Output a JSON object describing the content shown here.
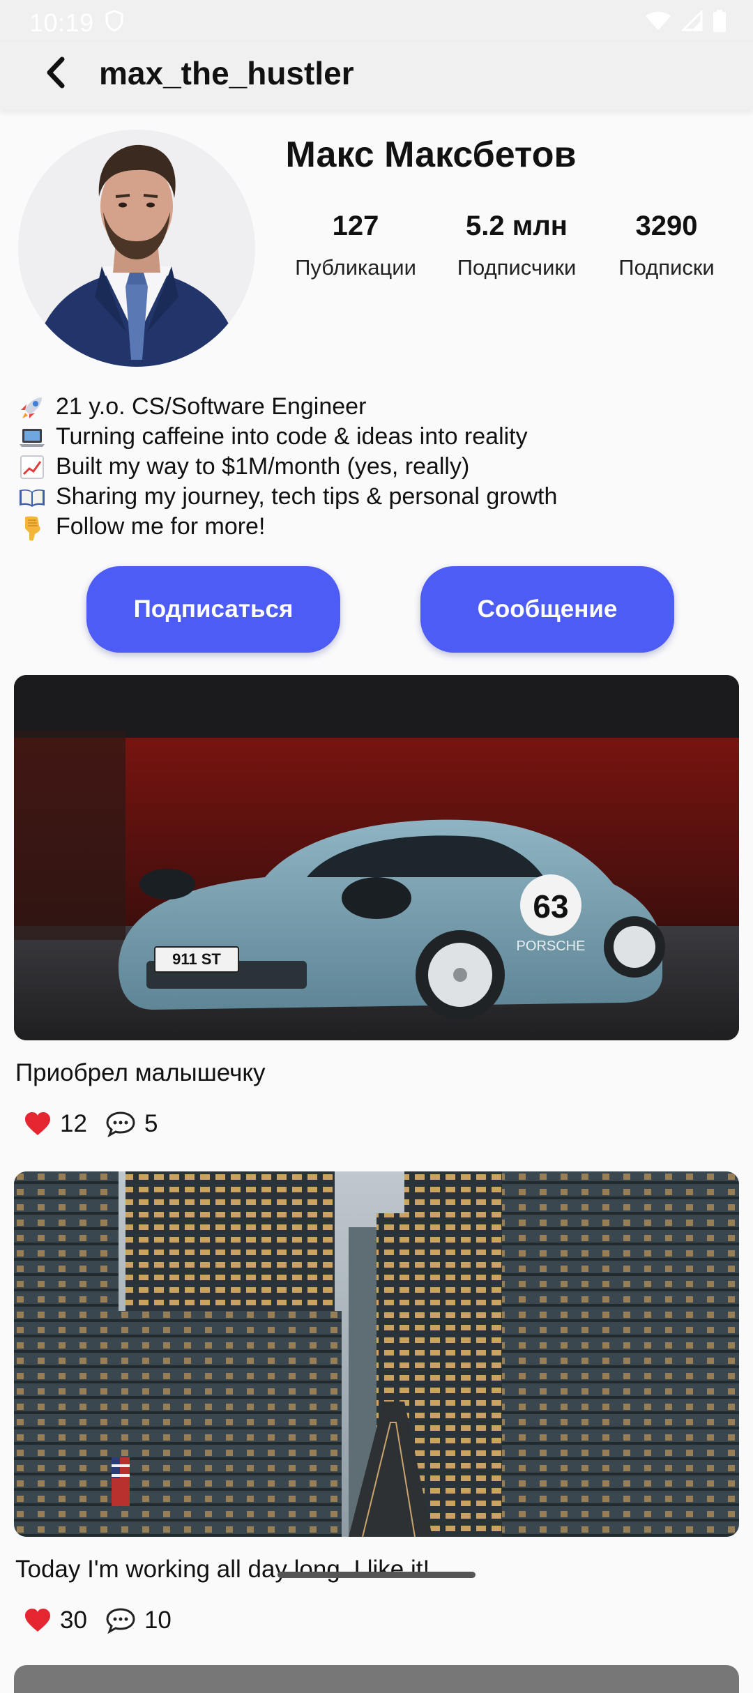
{
  "status_bar": {
    "time": "10:19",
    "icons": [
      "shield-icon",
      "wifi-icon",
      "signal-icon",
      "battery-icon"
    ]
  },
  "app_bar": {
    "username": "max_the_hustler"
  },
  "profile": {
    "name": "Макс Максбетов",
    "stats": [
      {
        "value": "127",
        "label": "Публикации"
      },
      {
        "value": "5.2 млн",
        "label": "Подписчики"
      },
      {
        "value": "3290",
        "label": "Подписки"
      }
    ],
    "bio": [
      {
        "icon": "rocket-icon",
        "text": "21 y.o. CS/Software Engineer"
      },
      {
        "icon": "laptop-icon",
        "text": "Turning caffeine into code & ideas into reality"
      },
      {
        "icon": "chart-increasing-icon",
        "text": "Built my way to $1M/month (yes, really)"
      },
      {
        "icon": "open-book-icon",
        "text": "Sharing my journey, tech tips & personal growth"
      },
      {
        "icon": "pointing-down-icon",
        "text": "Follow me for more!"
      }
    ]
  },
  "actions": {
    "subscribe_label": "Подписаться",
    "message_label": "Сообщение"
  },
  "posts": [
    {
      "caption": "Приобрел малышечку",
      "likes": "12",
      "comments": "5",
      "car_plate": "911 ST",
      "car_number": "63",
      "car_brand": "PORSCHE"
    },
    {
      "caption": "Today I'm working all day long. I like it!",
      "likes": "30",
      "comments": "10"
    }
  ],
  "colors": {
    "accent": "#4d5cf5",
    "background": "#fafafb",
    "app_bar": "#f0f0f1",
    "heart": "#e3262f"
  }
}
